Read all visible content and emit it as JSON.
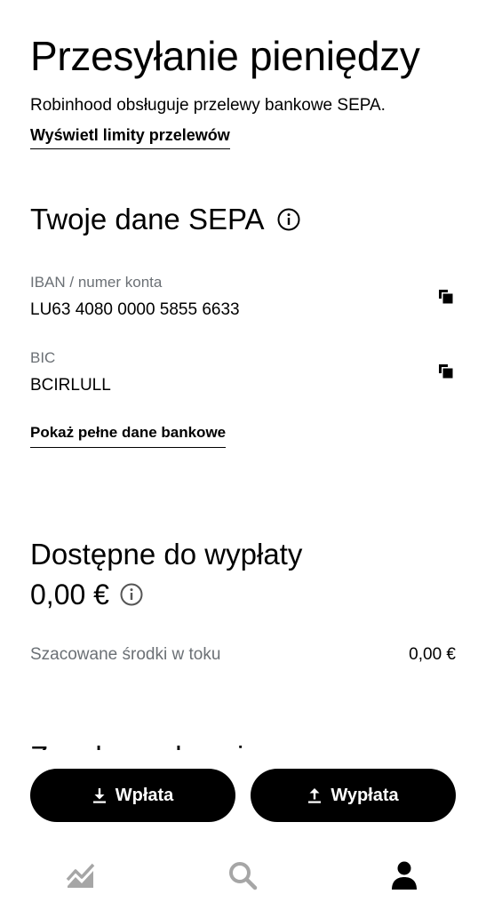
{
  "header": {
    "title": "Przesyłanie pieniędzy",
    "subtitle": "Robinhood obsługuje przelewy bankowe SEPA.",
    "limits_link": "Wyświetl limity przelewów"
  },
  "sepa": {
    "title": "Twoje dane SEPA",
    "iban_label": "IBAN / numer konta",
    "iban_value": "LU63 4080 0000 5855 6633",
    "bic_label": "BIC",
    "bic_value": "BCIRLULL",
    "bank_details_link": "Pokaż pełne dane bankowe"
  },
  "available": {
    "title": "Dostępne do wypłaty",
    "amount": "0,00 €",
    "pending_label": "Szacowane środki w toku",
    "pending_value": "0,00 €",
    "next_heading_partial": "Zasoby na koncie"
  },
  "actions": {
    "deposit_label": "Wpłata",
    "withdraw_label": "Wypłata"
  },
  "icons": {
    "info": "info-icon",
    "copy": "copy-icon",
    "download": "download-arrow-icon",
    "upload": "upload-arrow-icon",
    "tab_chart": "chart-icon",
    "tab_search": "search-icon",
    "tab_account": "person-icon"
  },
  "colors": {
    "text": "#000000",
    "secondary_text": "#6b7075",
    "button_bg": "#000000",
    "button_text": "#ffffff",
    "tab_inactive": "#a6a6a6",
    "tab_active": "#000000"
  }
}
